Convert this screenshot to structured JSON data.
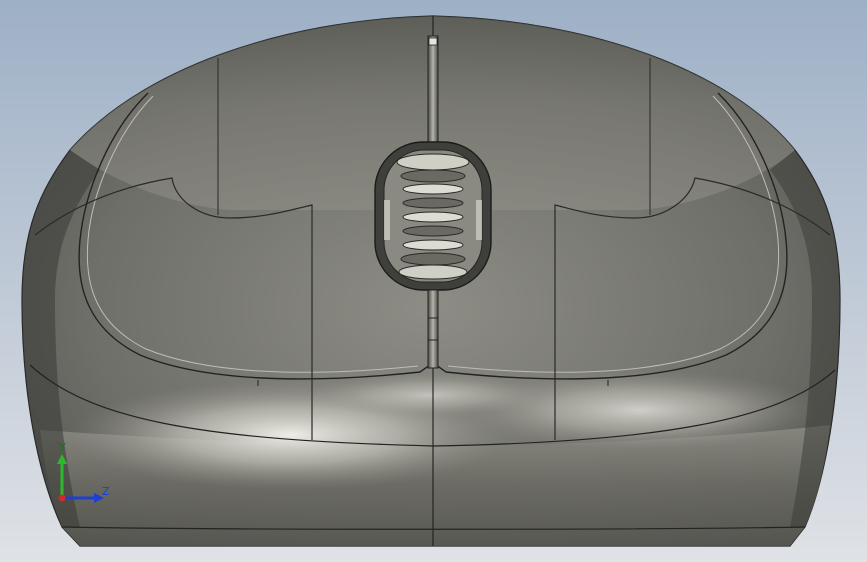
{
  "viewport": {
    "background_top": "#9fb0c6",
    "background_bottom": "#d9dde3",
    "model": "computer-mouse-shell-bottom-view"
  },
  "triad": {
    "y_label": "Y",
    "z_label": "Z",
    "y_color": "#2eb82e",
    "z_color": "#1f3fd1",
    "x_color": "#d12a2a"
  }
}
